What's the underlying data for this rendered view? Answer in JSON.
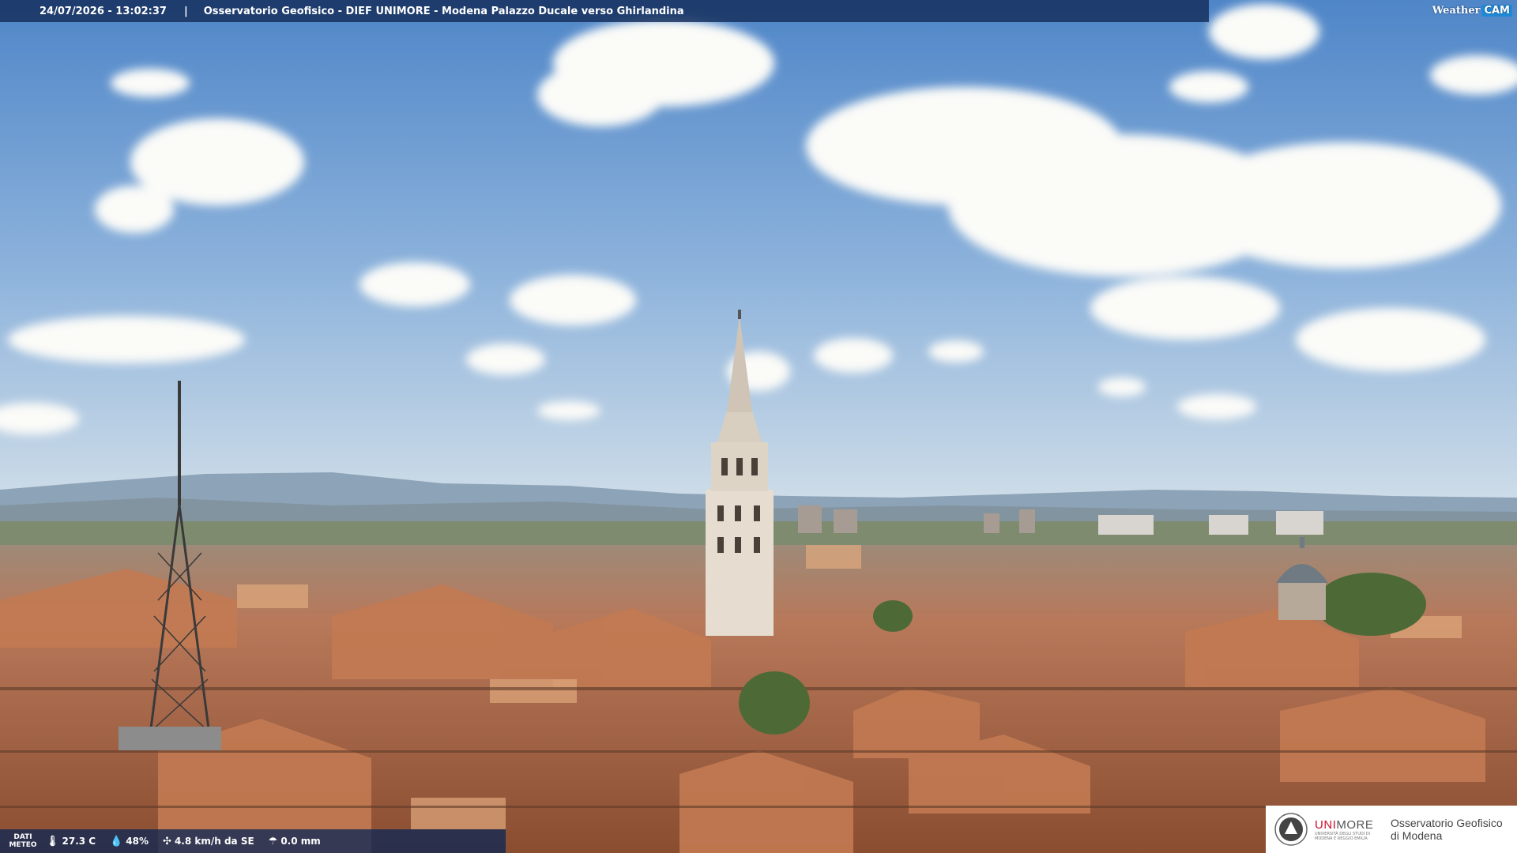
{
  "overlay": {
    "timestamp": "24/07/2026 - 13:02:37",
    "separator": "|",
    "title": "Osservatorio Geofisico - DIEF UNIMORE - Modena Palazzo Ducale verso Ghirlandina"
  },
  "brand": {
    "weather": "Weather",
    "cam": "CAM"
  },
  "weather_bar": {
    "label_line1": "DATI",
    "label_line2": "METEO",
    "temperature": "27.3 C",
    "humidity": "48%",
    "wind": "4.8 km/h da SE",
    "rain": "0.0 mm",
    "icons": [
      "thermometer-icon",
      "humidity-drop-icon",
      "wind-icon",
      "rain-gauge-icon"
    ]
  },
  "logo": {
    "university": "UNIMORE",
    "university_prefix": "UNI",
    "university_suffix": "MORE",
    "university_subtitle": "UNIVERSITÀ DEGLI STUDI DI MODENA E REGGIO EMILIA",
    "observatory_line1": "Osservatorio Geofisico",
    "observatory_line2": "di Modena"
  },
  "colors": {
    "sky_top": "#5d8fcf",
    "sky_bottom": "#c7d8e6",
    "roofs": "#b8704a",
    "overlay_bar": "#142d5a",
    "brand_accent": "#c8102e"
  }
}
